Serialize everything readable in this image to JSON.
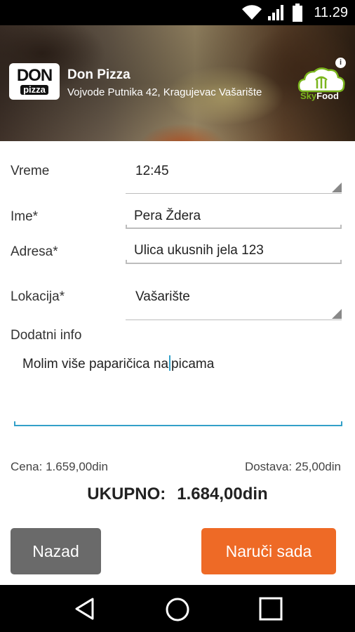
{
  "status_bar": {
    "time": "11.29",
    "wifi_icon": "wifi-icon",
    "signal_icon": "signal-icon",
    "battery_icon": "battery-icon"
  },
  "header": {
    "logo_top": "DON",
    "logo_bottom": "pizza",
    "shop_name": "Don Pizza",
    "address": "Vojvode Putnika 42, Kragujevac Vašarište",
    "skyfood_sky": "Sky",
    "skyfood_food": "Food",
    "info_glyph": "i"
  },
  "form": {
    "time_label": "Vreme",
    "time_value": "12:45",
    "name_label": "Ime*",
    "name_value": "Pera Ždera",
    "address_label": "Adresa*",
    "address_value": "Ulica ukusnih jela 123",
    "location_label": "Lokacija*",
    "location_value": "Vašarište",
    "info_label": "Dodatni info",
    "info_value_before": "Molim više paparičica na",
    "info_value_after": "picama"
  },
  "summary": {
    "price": "Cena: 1.659,00din",
    "delivery": "Dostava: 25,00din",
    "total_label": "UKUPNO:",
    "total_value": "1.684,00din"
  },
  "buttons": {
    "back": "Nazad",
    "order": "Naruči sada"
  },
  "colors": {
    "accent": "#ee6a26",
    "back_button": "#6a6a6a",
    "focus_line": "#33a0c8"
  }
}
